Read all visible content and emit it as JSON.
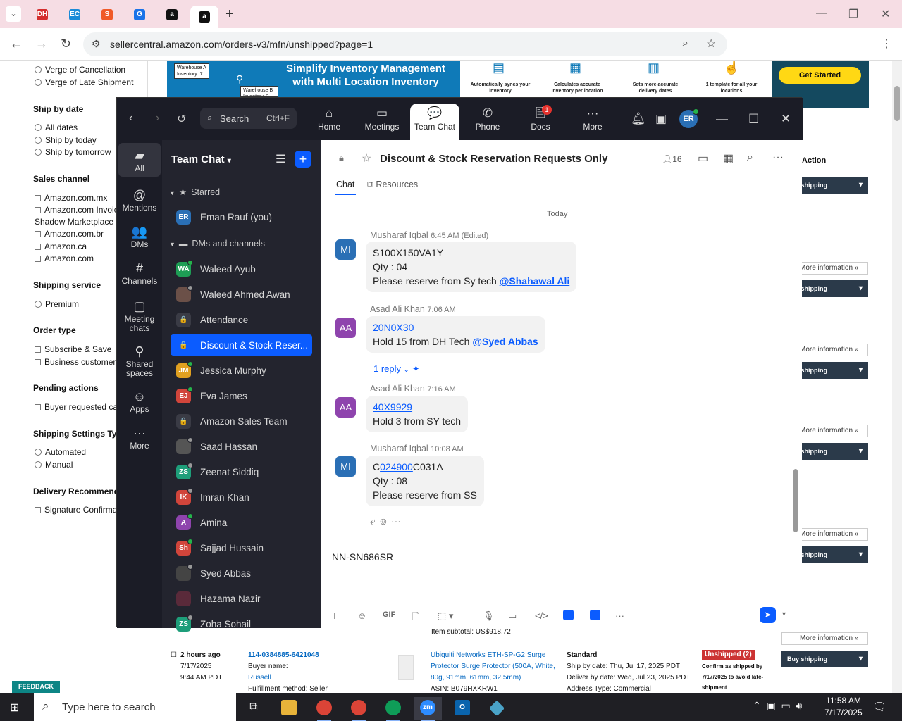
{
  "browser": {
    "url": "sellercentral.amazon.com/orders-v3/mfn/unshipped?page=1",
    "tabs": [
      {
        "glyph": "DH",
        "color": "#d42e2e"
      },
      {
        "glyph": "EC",
        "color": "#1a8bd8"
      },
      {
        "glyph": "S",
        "color": "#f05a28"
      },
      {
        "glyph": "G",
        "color": "#1a73e8"
      },
      {
        "glyph": "a",
        "color": "#111111"
      },
      {
        "glyph": "a",
        "color": "#111111"
      }
    ],
    "profile_letter": "E"
  },
  "amazon": {
    "filters": [
      {
        "type": "radio",
        "label": "Verge of Cancellation"
      },
      {
        "type": "radio",
        "label": "Verge of Late Shipment"
      },
      {
        "type": "head",
        "label": "Ship by date"
      },
      {
        "type": "radio",
        "label": "All dates"
      },
      {
        "type": "radio",
        "label": "Ship by today"
      },
      {
        "type": "radio",
        "label": "Ship by tomorrow"
      },
      {
        "type": "head",
        "label": "Sales channel"
      },
      {
        "type": "check",
        "label": "Amazon.com.mx"
      },
      {
        "type": "check",
        "label": "Amazon.com Invoicing"
      },
      {
        "type": "plain",
        "label": "Shadow Marketplace"
      },
      {
        "type": "check",
        "label": "Amazon.com.br"
      },
      {
        "type": "check",
        "label": "Amazon.ca"
      },
      {
        "type": "check",
        "label": "Amazon.com"
      },
      {
        "type": "head",
        "label": "Shipping service"
      },
      {
        "type": "radio",
        "label": "Premium"
      },
      {
        "type": "head",
        "label": "Order type"
      },
      {
        "type": "check",
        "label": "Subscribe & Save"
      },
      {
        "type": "check",
        "label": "Business customer"
      },
      {
        "type": "head",
        "label": "Pending actions"
      },
      {
        "type": "check",
        "label": "Buyer requested cancellation"
      },
      {
        "type": "head",
        "label": "Shipping Settings Type"
      },
      {
        "type": "radio",
        "label": "Automated"
      },
      {
        "type": "radio",
        "label": "Manual"
      },
      {
        "type": "head",
        "label": "Delivery Recommendations"
      },
      {
        "type": "check",
        "label": "Signature Confirmation"
      }
    ],
    "banner": {
      "title": "Simplify Inventory Management with Multi Location Inventory",
      "warehouse_a": "Warehouse A Inventory: 7",
      "warehouse_b": "Warehouse B Inventory: 3",
      "features": [
        "Automatically syncs your inventory",
        "Calculates accurate inventory per location",
        "Sets more accurate delivery dates",
        "1 template for all your locations"
      ],
      "cta": "Get Started"
    },
    "action_header": "Action",
    "buy_shipping_label": "Buy shipping",
    "more_info_label": "More information »",
    "order": {
      "age": "2 hours ago",
      "date": "7/17/2025",
      "time": "9:44 AM PDT",
      "order_id": "114-0384885-6421048",
      "buyer_label": "Buyer name:",
      "buyer": "Russell",
      "fulfillment": "Fulfillment method: Seller",
      "subtotal": "Item subtotal: US$918.72",
      "product": "Ubiquiti Networks ETH-SP-G2 Surge Protector Surge Protector (500A, White, 80g, 91mm, 61mm, 32.5mm)",
      "asin": "ASIN: B079HXKRW1",
      "service": "Standard",
      "ship_by": "Ship by date: Thu, Jul 17, 2025 PDT",
      "deliver_by": "Deliver by date: Wed, Jul 23, 2025 PDT",
      "address_type": "Address Type:  Commercial",
      "status": "Unshipped (2)",
      "status_note": "Confirm as shipped by 7/17/2025 to avoid late-shipment"
    },
    "feedback": "FEEDBACK"
  },
  "zoom": {
    "search_placeholder": "Search",
    "search_shortcut": "Ctrl+F",
    "nav_tabs": [
      {
        "label": "Home",
        "icon": "⌂"
      },
      {
        "label": "Meetings",
        "icon": "▭"
      },
      {
        "label": "Team Chat",
        "icon": "💬"
      },
      {
        "label": "Phone",
        "icon": "✆"
      },
      {
        "label": "Docs",
        "icon": "🗎"
      },
      {
        "label": "More",
        "icon": "···"
      }
    ],
    "docs_badge": "1",
    "avatar_initials": "ER",
    "rail": [
      {
        "label": "All",
        "icon": "▰"
      },
      {
        "label": "Mentions",
        "icon": "@"
      },
      {
        "label": "DMs",
        "icon": "👥"
      },
      {
        "label": "Channels",
        "icon": "#"
      },
      {
        "label": "Meeting chats",
        "icon": "▢"
      },
      {
        "label": "Shared spaces",
        "icon": "⚲"
      },
      {
        "label": "Apps",
        "icon": "☺"
      },
      {
        "label": "More",
        "icon": "···"
      }
    ],
    "sidebar": {
      "title": "Team Chat",
      "starred_label": "Starred",
      "dms_label": "DMs and channels",
      "starred": [
        {
          "initials": "ER",
          "color": "#2a6fb5",
          "name": "Eman Rauf (you)",
          "status": "none"
        }
      ],
      "channels": [
        {
          "initials": "WA",
          "color": "#1e9e55",
          "name": "Waleed Ayub",
          "status": "on"
        },
        {
          "initials": "",
          "color": "#6b5048",
          "name": "Waleed Ahmed Awan",
          "status": "off"
        },
        {
          "initials": "🔒",
          "color": "#3a3b45",
          "name": "Attendance",
          "status": "none"
        },
        {
          "initials": "🔒",
          "color": "#0b5cff",
          "name": "Discount & Stock Reser...",
          "status": "none",
          "selected": true
        },
        {
          "initials": "JM",
          "color": "#e0a020",
          "name": "Jessica Murphy",
          "status": "on"
        },
        {
          "initials": "EJ",
          "color": "#d1453b",
          "name": "Eva James",
          "status": "on"
        },
        {
          "initials": "🔒",
          "color": "#3a3b45",
          "name": "Amazon Sales Team",
          "status": "none"
        },
        {
          "initials": "",
          "color": "#555555",
          "name": "Saad Hassan",
          "status": "off"
        },
        {
          "initials": "ZS",
          "color": "#1e9e7a",
          "name": "Zeenat Siddiq",
          "status": "off"
        },
        {
          "initials": "IK",
          "color": "#d1453b",
          "name": "Imran Khan",
          "status": "off"
        },
        {
          "initials": "A",
          "color": "#8e44ad",
          "name": "Amina",
          "status": "on"
        },
        {
          "initials": "Sh",
          "color": "#d1453b",
          "name": "Sajjad Hussain",
          "status": "on"
        },
        {
          "initials": "",
          "color": "#444444",
          "name": "Syed Abbas",
          "status": "off"
        },
        {
          "initials": "",
          "color": "#5a2a3a",
          "name": "Hazama Nazir",
          "status": "none"
        },
        {
          "initials": "ZS",
          "color": "#1e9e7a",
          "name": "Zoha Sohail",
          "status": "off"
        }
      ]
    },
    "channel": {
      "title": "Discount & Stock Reservation Requests Only",
      "member_count": "16",
      "tab_chat": "Chat",
      "tab_resources": "Resources",
      "day_divider": "Today",
      "messages": [
        {
          "initials": "MI",
          "color": "#2a6fb5",
          "author": "Musharaf Iqbal",
          "time": "6:45 AM (Edited)",
          "lines": [
            "S100X150VA1Y",
            "Qty  : 04"
          ],
          "last_text": "Please reserve from Sy tech ",
          "mention": "@Shahawal Ali"
        },
        {
          "initials": "AA",
          "color": "#8e44ad",
          "author": "Asad Ali Khan",
          "time": "7:06 AM",
          "link": "20N0X30",
          "last_text": "Hold 15 from DH Tech ",
          "mention": "@Syed Abbas",
          "reply": "1 reply"
        },
        {
          "initials": "AA",
          "color": "#8e44ad",
          "author": "Asad Ali Khan",
          "time": "7:16 AM",
          "link": "40X9929",
          "last_text": "Hold 3 from SY tech"
        },
        {
          "initials": "MI",
          "color": "#2a6fb5",
          "author": "Musharaf Iqbal",
          "time": "10:08 AM",
          "pre": "C",
          "link": "024900",
          "post": "C031A",
          "lines": [
            "Qty : 08",
            "Please reserve from SS"
          ]
        }
      ]
    },
    "composer_text": "NN-SN686SR"
  },
  "taskbar": {
    "search_placeholder": "Type here to search",
    "time": "11:58 AM",
    "date": "7/17/2025"
  }
}
